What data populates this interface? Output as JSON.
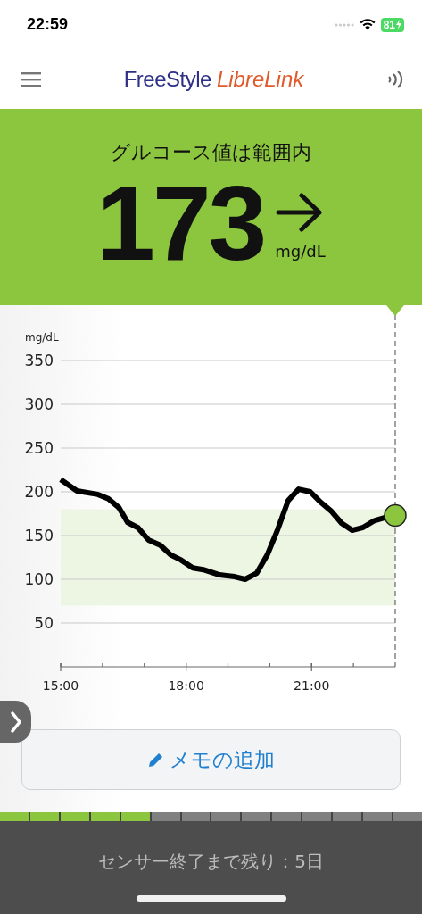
{
  "status_bar": {
    "time": "22:59",
    "battery": "81",
    "charging": true
  },
  "header": {
    "logo": [
      "FreeStyle",
      "LibreLink"
    ]
  },
  "banner": {
    "status": "グルコース値は範囲内",
    "value": "173",
    "unit": "mg/dL",
    "color": "#8cc63f"
  },
  "chart": {
    "chart_data": {
      "type": "line",
      "ylabel": "mg/dL",
      "xlim": [
        15,
        23
      ],
      "ylim": [
        0,
        350
      ],
      "xticks": [
        {
          "value": 15,
          "label": "15:00"
        },
        {
          "value": 18,
          "label": "18:00"
        },
        {
          "value": 21,
          "label": "21:00"
        }
      ],
      "yticks": [
        50,
        100,
        150,
        200,
        250,
        300,
        350
      ],
      "x": [
        15,
        15.39,
        15.89,
        16.14,
        16.39,
        16.6,
        16.85,
        17.1,
        17.38,
        17.63,
        17.88,
        18.16,
        18.41,
        18.8,
        19.16,
        19.41,
        19.69,
        19.94,
        20.19,
        20.44,
        20.69,
        20.97,
        21.22,
        21.47,
        21.72,
        21.97,
        22.22,
        22.5,
        22.79,
        23
      ],
      "series": [
        {
          "color": "#000000",
          "values": [
            214,
            201,
            197,
            192,
            182,
            165,
            159,
            145,
            139,
            128,
            122,
            113,
            111,
            105,
            103,
            100,
            107,
            128,
            157,
            190,
            203,
            200,
            188,
            178,
            164,
            156,
            159,
            167,
            171,
            173
          ]
        }
      ],
      "grid": true,
      "bands": [
        {
          "axis": "y",
          "from": 70,
          "to": 180
        }
      ]
    }
  },
  "memo_button": {
    "label": "メモの追加"
  },
  "sensor": {
    "segments": [
      {
        "filled": true
      },
      {
        "filled": true
      },
      {
        "filled": true
      },
      {
        "filled": true
      },
      {
        "filled": true
      },
      {
        "filled": false
      },
      {
        "filled": false
      },
      {
        "filled": false
      },
      {
        "filled": false
      },
      {
        "filled": false
      },
      {
        "filled": false
      },
      {
        "filled": false
      },
      {
        "filled": false
      },
      {
        "filled": false
      }
    ],
    "text": "センサー終了まで残り：5日"
  }
}
